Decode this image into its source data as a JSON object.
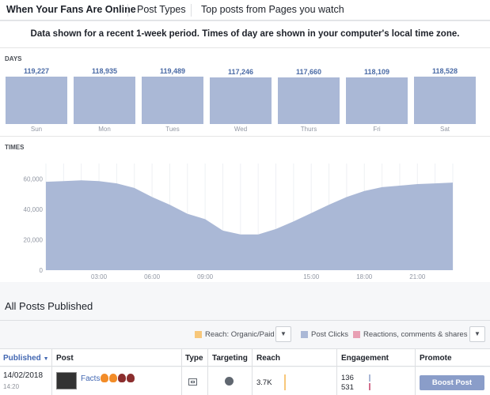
{
  "tabs": [
    "When Your Fans Are Online",
    "Post Types",
    "Top posts from Pages you watch"
  ],
  "notice": "Data shown for a recent 1-week period. Times of day are shown in your computer's local time zone.",
  "days_title": "DAYS",
  "days": [
    {
      "label": "Sun",
      "value": "119,227",
      "number": 119227
    },
    {
      "label": "Mon",
      "value": "118,935",
      "number": 118935
    },
    {
      "label": "Tues",
      "value": "119,489",
      "number": 119489
    },
    {
      "label": "Wed",
      "value": "117,246",
      "number": 117246
    },
    {
      "label": "Thurs",
      "value": "117,660",
      "number": 117660
    },
    {
      "label": "Fri",
      "value": "118,109",
      "number": 118109
    },
    {
      "label": "Sat",
      "value": "118,528",
      "number": 118528
    }
  ],
  "times_title": "TIMES",
  "chart_data": {
    "type": "area",
    "title": "TIMES",
    "x_ticks": [
      "03:00",
      "06:00",
      "09:00",
      "15:00",
      "18:00",
      "21:00"
    ],
    "y_ticks": [
      "60,000",
      "40,000",
      "20,000",
      "0"
    ],
    "ylim": [
      0,
      70000
    ],
    "x": [
      0,
      1,
      2,
      3,
      4,
      5,
      6,
      7,
      8,
      9,
      10,
      11,
      12,
      13,
      14,
      15,
      16,
      17,
      18,
      19,
      20,
      21,
      22,
      23
    ],
    "values": [
      58000,
      58500,
      59000,
      58500,
      57000,
      54000,
      48000,
      43000,
      37000,
      33500,
      26000,
      23500,
      23500,
      27000,
      32000,
      37500,
      43000,
      48000,
      52000,
      54500,
      55500,
      56500,
      57000,
      57500
    ],
    "grid": true,
    "color": "#aab8d6"
  },
  "all_posts": {
    "title": "All Posts Published",
    "legend": [
      {
        "label": "Reach: Organic/Paid",
        "color": "#f7c77a"
      },
      {
        "label": "Post Clicks",
        "color": "#aab8d6"
      },
      {
        "label": "Reactions, comments & shares",
        "color": "#e8a0b4"
      }
    ],
    "dropdown_icon": "▼",
    "columns": [
      "Published",
      "Post",
      "Type",
      "Targeting",
      "Reach",
      "Engagement",
      "Promote"
    ],
    "row": {
      "date": "14/02/2018",
      "time": "14:20",
      "post_title": "Facts",
      "reach": "3.7K",
      "engagement_clicks": "136",
      "engagement_reactions": "531",
      "boost_label": "Boost Post"
    }
  }
}
